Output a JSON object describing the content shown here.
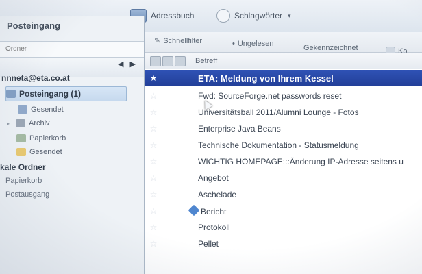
{
  "toolbar": {
    "address_book": "Adressbuch",
    "tags": "Schlagwörter"
  },
  "left": {
    "title": "Posteingang",
    "search_placeholder": "Ordner",
    "account": "nnneta@eta.co.at",
    "folders": [
      {
        "label": "Posteingang (1)",
        "icon": "inbox-icon"
      },
      {
        "label": "Gesendet",
        "icon": "sent-icon"
      },
      {
        "label": "Archiv",
        "icon": "archive-icon"
      },
      {
        "label": "Papierkorb",
        "icon": "trash-icon"
      },
      {
        "label": "Gesendet",
        "icon": "folder-icon"
      }
    ],
    "local_title": "kale Ordner",
    "local_folders": [
      "Papierkorb",
      "Postausgang"
    ]
  },
  "filters": {
    "quick_filter": "Schnellfilter",
    "unread": "Ungelesen",
    "flagged": "Gekennzeichnet",
    "contact": "Ko"
  },
  "columns": {
    "subject": "Betreff"
  },
  "messages": [
    {
      "subject": "ETA: Meldung von Ihrem Kessel",
      "selected": true
    },
    {
      "subject": "Fwd: SourceForge.net passwords reset",
      "selected": false
    },
    {
      "subject": "Universitätsball 2011/Alumni Lounge - Fotos",
      "selected": false
    },
    {
      "subject": "Enterprise Java Beans",
      "selected": false
    },
    {
      "subject": "Technische Dokumentation - Statusmeldung",
      "selected": false
    },
    {
      "subject": "WICHTIG HOMEPAGE:::Änderung IP-Adresse seitens u",
      "selected": false
    },
    {
      "subject": "Angebot",
      "selected": false
    },
    {
      "subject": "Aschelade",
      "selected": false
    },
    {
      "subject": "Bericht",
      "selected": false
    },
    {
      "subject": "Protokoll",
      "selected": false
    },
    {
      "subject": "Pellet",
      "selected": false
    }
  ],
  "colors": {
    "selected_row": "#2f52b5",
    "panel_bg": "#eef2f6"
  }
}
